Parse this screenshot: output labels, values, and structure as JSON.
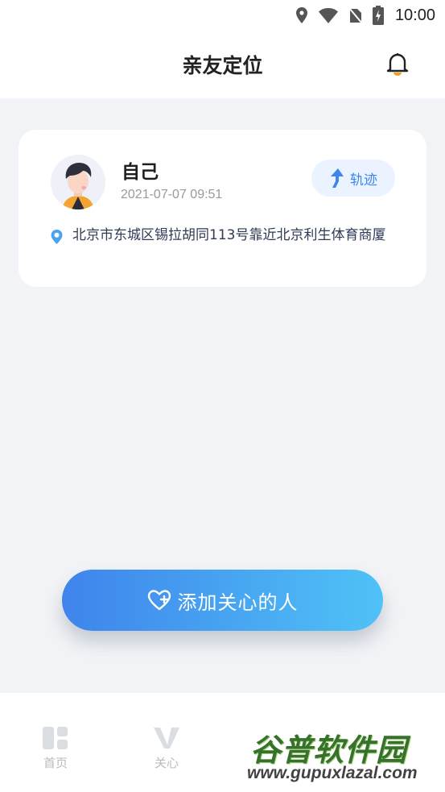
{
  "status_bar": {
    "time": "10:00"
  },
  "header": {
    "title": "亲友定位"
  },
  "card": {
    "name": "自己",
    "timestamp": "2021-07-07 09:51",
    "track_label": "轨迹",
    "address": "北京市东城区锡拉胡同113号靠近北京利生体育商厦"
  },
  "add_button": {
    "label": "添加关心的人"
  },
  "tabs": [
    {
      "label": "首页",
      "icon": "home-icon"
    },
    {
      "label": "关心",
      "icon": "care-icon"
    }
  ],
  "watermark": {
    "main": "谷普软件园",
    "url": "www.gupuxlazal.com"
  },
  "colors": {
    "accent": "#3f86ec",
    "gradient_end": "#4fc2f6",
    "background": "#f2f3f6",
    "tab_inactive": "#b7bbc2"
  }
}
